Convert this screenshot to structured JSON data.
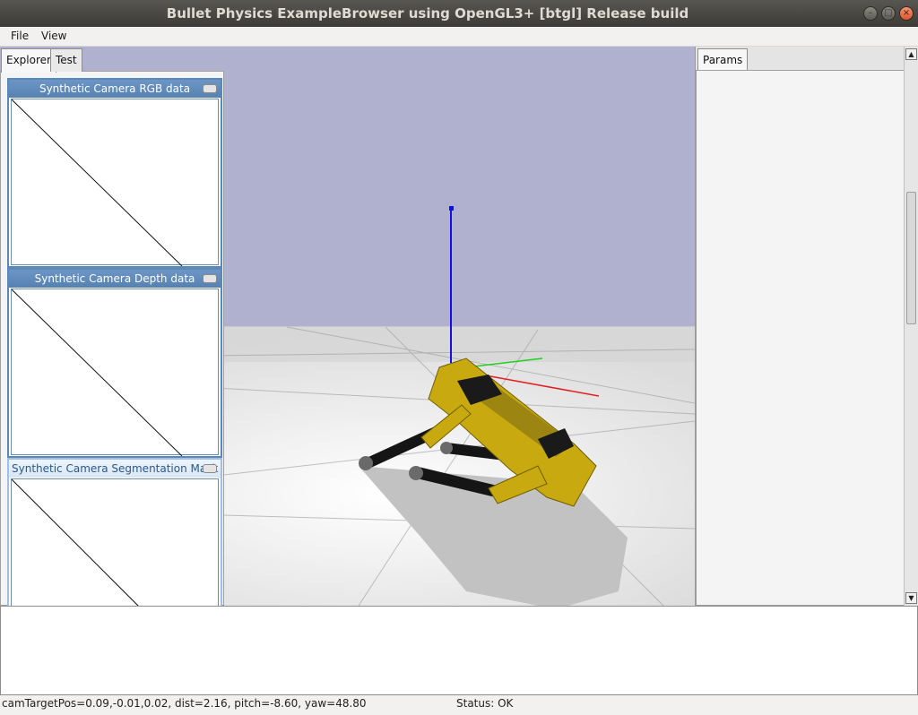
{
  "window": {
    "title": "Bullet Physics ExampleBrowser using OpenGL3+ [btgl] Release build",
    "buttons": {
      "minimize": "–",
      "maximize": "□",
      "close": "×"
    }
  },
  "menu": {
    "file": "File",
    "view": "View"
  },
  "explorer": {
    "tabs": [
      {
        "label": "Explorer"
      },
      {
        "label": "Test"
      }
    ],
    "camera_windows": [
      {
        "title": "Synthetic Camera RGB data"
      },
      {
        "title": "Synthetic Camera Depth data"
      },
      {
        "title": "Synthetic Camera Segmentation Mask"
      }
    ]
  },
  "params": {
    "tab_label": "Params",
    "scroll_up": "▲",
    "scroll_down": "▼"
  },
  "scene": {
    "sky_color": "#b0b0cf",
    "floor_color": "#e8e8e8",
    "robot_body_color": "#c8aa10",
    "robot_joint_color": "#1a1a1a",
    "axis_colors": {
      "x": "#e02020",
      "y": "#20d020",
      "z": "#1010e0"
    }
  },
  "status": {
    "camera": "camTargetPos=0.09,-0.01,0.02, dist=2.16, pitch=-8.60, yaw=48.80",
    "state": "Status: OK"
  }
}
